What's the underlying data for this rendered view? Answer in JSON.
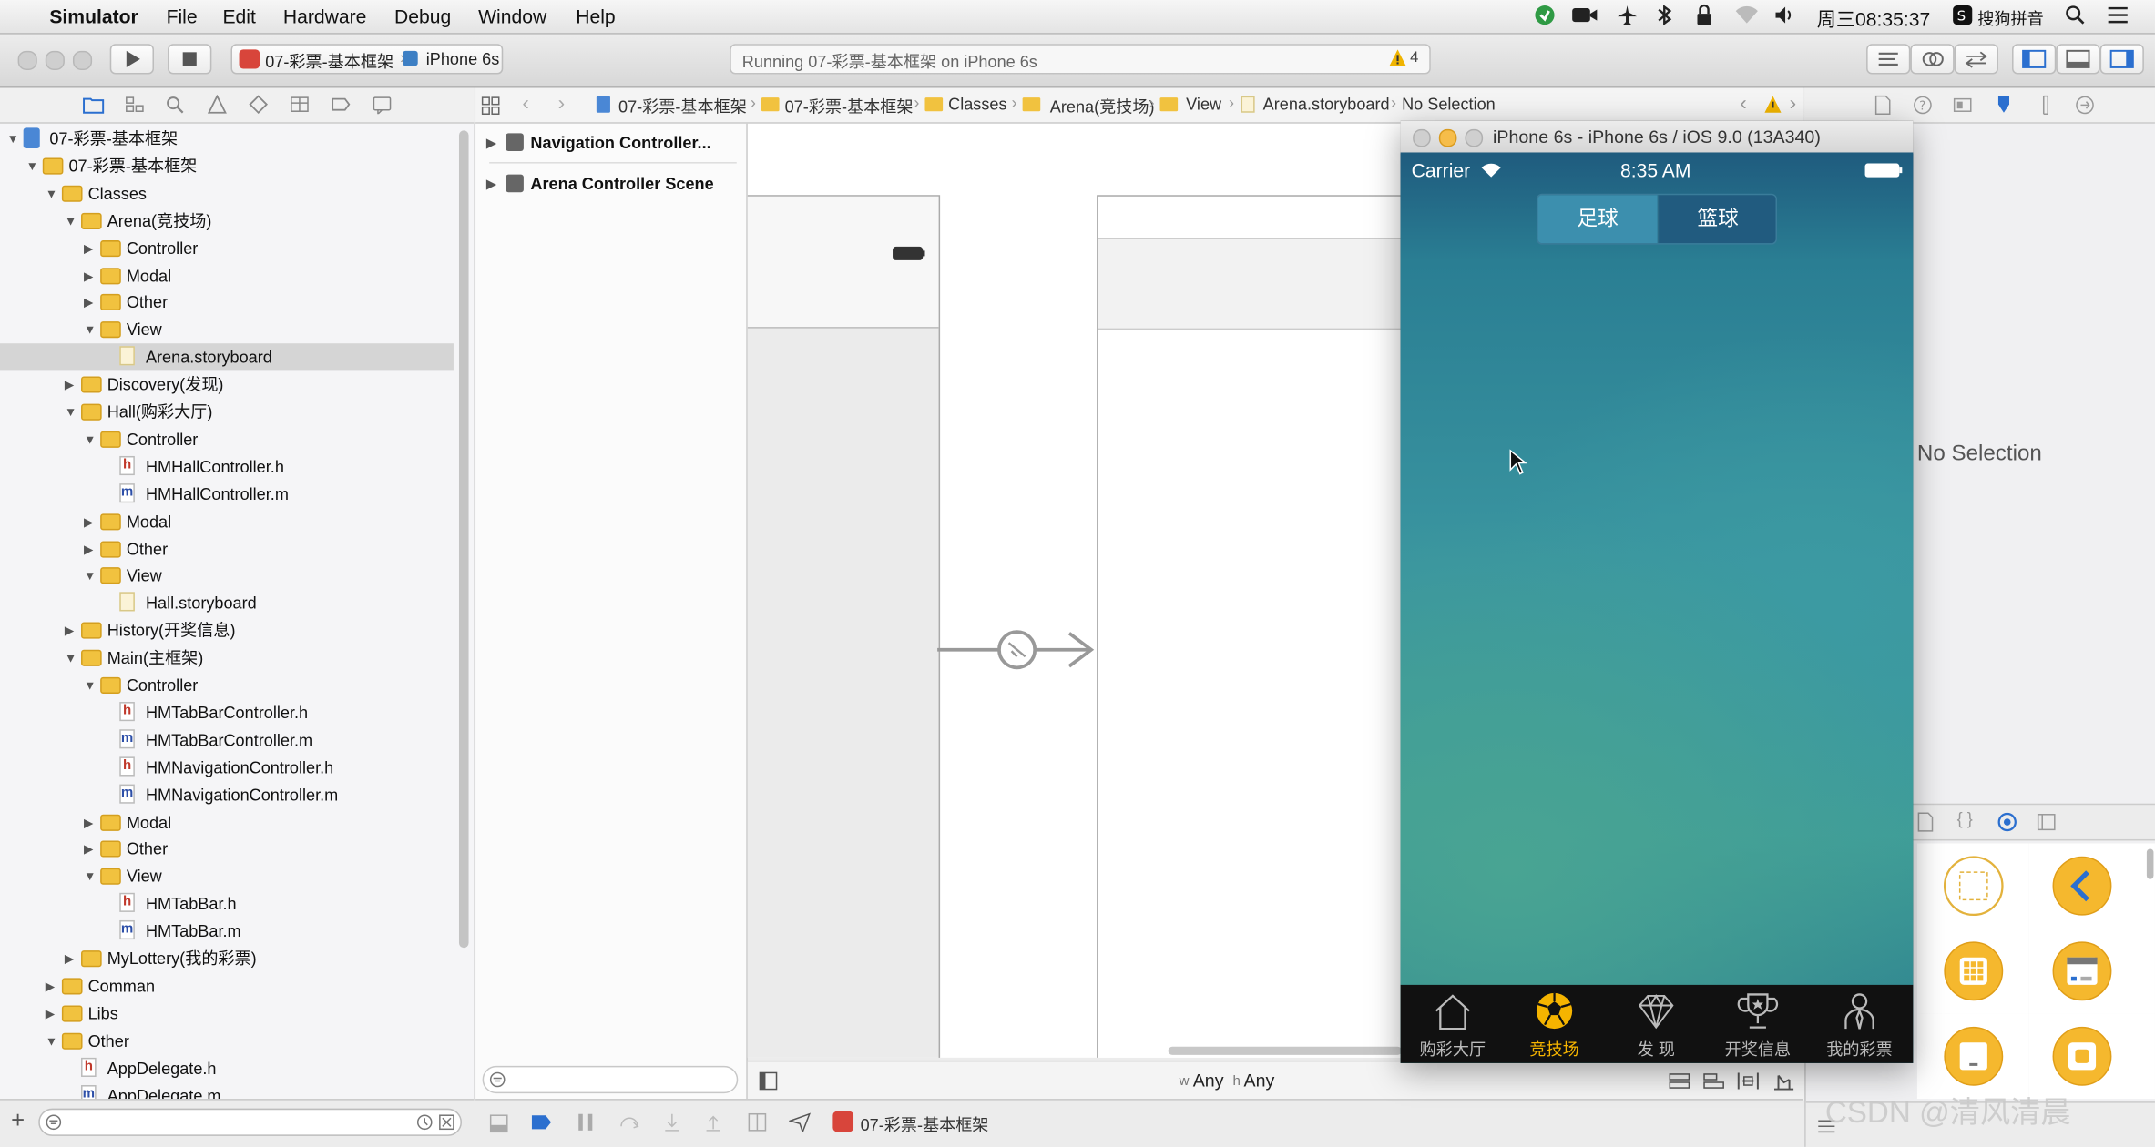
{
  "menubar": {
    "app": "Simulator",
    "items": [
      "File",
      "Edit",
      "Hardware",
      "Debug",
      "Window",
      "Help"
    ],
    "clock": "周三08:35:37",
    "input_method": "搜狗拼音"
  },
  "toolbar": {
    "scheme": "07-彩票-基本框架",
    "device": "iPhone 6s",
    "activity": "Running 07-彩票-基本框架 on iPhone 6s",
    "warnings": "4"
  },
  "jumpbar": {
    "crumbs": [
      "07-彩票-基本框架",
      "07-彩票-基本框架",
      "Classes",
      "Arena(竞技场)",
      "View",
      "Arena.storyboard",
      "No Selection"
    ]
  },
  "navigator": {
    "items": [
      {
        "label": "07-彩票-基本框架",
        "indent": 0,
        "kind": "project",
        "open": true
      },
      {
        "label": "07-彩票-基本框架",
        "indent": 1,
        "kind": "folder",
        "open": true
      },
      {
        "label": "Classes",
        "indent": 2,
        "kind": "folder",
        "open": true
      },
      {
        "label": "Arena(竞技场)",
        "indent": 3,
        "kind": "folder",
        "open": true
      },
      {
        "label": "Controller",
        "indent": 4,
        "kind": "folder",
        "open": false
      },
      {
        "label": "Modal",
        "indent": 4,
        "kind": "folder",
        "open": false
      },
      {
        "label": "Other",
        "indent": 4,
        "kind": "folder",
        "open": false
      },
      {
        "label": "View",
        "indent": 4,
        "kind": "folder",
        "open": true
      },
      {
        "label": "Arena.storyboard",
        "indent": 5,
        "kind": "storyboard",
        "selected": true
      },
      {
        "label": "Discovery(发现)",
        "indent": 3,
        "kind": "folder",
        "open": false
      },
      {
        "label": "Hall(购彩大厅)",
        "indent": 3,
        "kind": "folder",
        "open": true
      },
      {
        "label": "Controller",
        "indent": 4,
        "kind": "folder",
        "open": true
      },
      {
        "label": "HMHallController.h",
        "indent": 5,
        "kind": "h"
      },
      {
        "label": "HMHallController.m",
        "indent": 5,
        "kind": "m"
      },
      {
        "label": "Modal",
        "indent": 4,
        "kind": "folder",
        "open": false
      },
      {
        "label": "Other",
        "indent": 4,
        "kind": "folder",
        "open": false
      },
      {
        "label": "View",
        "indent": 4,
        "kind": "folder",
        "open": true
      },
      {
        "label": "Hall.storyboard",
        "indent": 5,
        "kind": "storyboard"
      },
      {
        "label": "History(开奖信息)",
        "indent": 3,
        "kind": "folder",
        "open": false
      },
      {
        "label": "Main(主框架)",
        "indent": 3,
        "kind": "folder",
        "open": true
      },
      {
        "label": "Controller",
        "indent": 4,
        "kind": "folder",
        "open": true
      },
      {
        "label": "HMTabBarController.h",
        "indent": 5,
        "kind": "h"
      },
      {
        "label": "HMTabBarController.m",
        "indent": 5,
        "kind": "m"
      },
      {
        "label": "HMNavigationController.h",
        "indent": 5,
        "kind": "h"
      },
      {
        "label": "HMNavigationController.m",
        "indent": 5,
        "kind": "m"
      },
      {
        "label": "Modal",
        "indent": 4,
        "kind": "folder",
        "open": false
      },
      {
        "label": "Other",
        "indent": 4,
        "kind": "folder",
        "open": false
      },
      {
        "label": "View",
        "indent": 4,
        "kind": "folder",
        "open": true
      },
      {
        "label": "HMTabBar.h",
        "indent": 5,
        "kind": "h"
      },
      {
        "label": "HMTabBar.m",
        "indent": 5,
        "kind": "m"
      },
      {
        "label": "MyLottery(我的彩票)",
        "indent": 3,
        "kind": "folder",
        "open": false
      },
      {
        "label": "Comman",
        "indent": 2,
        "kind": "folder",
        "open": false
      },
      {
        "label": "Libs",
        "indent": 2,
        "kind": "folder",
        "open": false
      },
      {
        "label": "Other",
        "indent": 2,
        "kind": "folder",
        "open": true
      },
      {
        "label": "AppDelegate.h",
        "indent": 3,
        "kind": "h"
      },
      {
        "label": "AppDelegate.m",
        "indent": 3,
        "kind": "m"
      }
    ]
  },
  "outline": {
    "scenes": [
      "Navigation Controller...",
      "Arena Controller Scene"
    ]
  },
  "canvas": {
    "size_class": {
      "w_prefix": "w",
      "w_value": "Any",
      "h_prefix": "h",
      "h_value": "Any"
    }
  },
  "debug": {
    "target": "07-彩票-基本框架"
  },
  "inspector": {
    "no_selection": "No Selection"
  },
  "simulator": {
    "window_title": "iPhone 6s - iPhone 6s / iOS 9.0 (13A340)",
    "status": {
      "carrier": "Carrier",
      "time": "8:35 AM"
    },
    "segments": [
      "足球",
      "篮球"
    ],
    "tabs": [
      {
        "label": "购彩大厅",
        "icon": "house-icon",
        "active": false
      },
      {
        "label": "竞技场",
        "icon": "soccer-ball-icon",
        "active": true
      },
      {
        "label": "发 现",
        "icon": "diamond-icon",
        "active": false
      },
      {
        "label": "开奖信息",
        "icon": "trophy-icon",
        "active": false
      },
      {
        "label": "我的彩票",
        "icon": "person-icon",
        "active": false
      }
    ],
    "colors": {
      "active_tab": "#f5b400",
      "segment_selected": "#3c8fae"
    }
  },
  "watermark": "CSDN @清风清晨"
}
